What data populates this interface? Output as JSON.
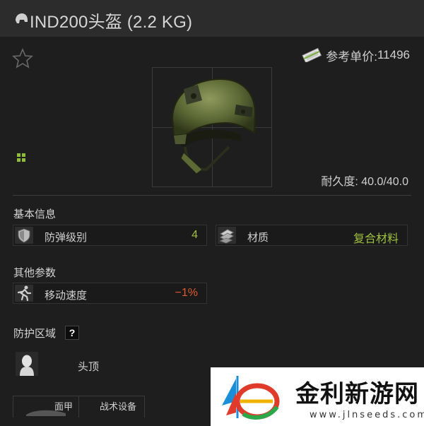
{
  "header": {
    "title": "IND200头盔 (2.2 KG)",
    "icon": "helmet-icon"
  },
  "item": {
    "price_label": "参考单价:",
    "price_value": "11496",
    "durability_label": "耐久度:",
    "durability_value": "40.0/40.0"
  },
  "basic_info": {
    "title": "基本信息",
    "armor_class_label": "防弹级别",
    "armor_class_value": "4",
    "material_label": "材质",
    "material_value": "复合材料"
  },
  "other_params": {
    "title": "其他参数",
    "move_speed_label": "移动速度",
    "move_speed_value": "−1%"
  },
  "protection": {
    "title": "防护区域",
    "help": "?",
    "zone_label": "头顶"
  },
  "tabs": {
    "face": "面甲",
    "tactical": "战术设备"
  },
  "watermark": {
    "title": "金利新游网",
    "url": "www.jlnseeds.com"
  },
  "colors": {
    "positive": "#9ec13f",
    "negative": "#e05a2a",
    "accent_green": "#8fbd3a"
  }
}
